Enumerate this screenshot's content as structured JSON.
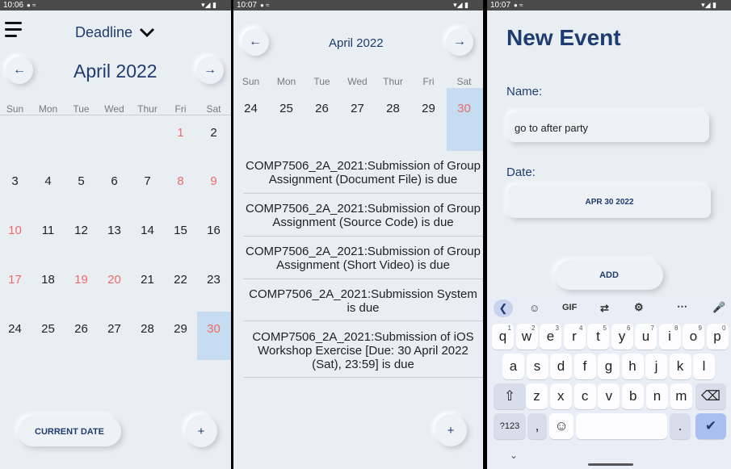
{
  "screen1": {
    "status_time": "10:06",
    "title": "Deadline",
    "month_label": "April 2022",
    "weekdays": [
      "Sun",
      "Mon",
      "Tue",
      "Wed",
      "Thur",
      "Fri",
      "Sat"
    ],
    "days": [
      [
        "",
        "",
        "",
        "",
        "",
        "1",
        "2"
      ],
      [
        "3",
        "4",
        "5",
        "6",
        "7",
        "8",
        "9"
      ],
      [
        "10",
        "11",
        "12",
        "13",
        "14",
        "15",
        "16"
      ],
      [
        "17",
        "18",
        "19",
        "20",
        "21",
        "22",
        "23"
      ],
      [
        "24",
        "25",
        "26",
        "27",
        "28",
        "29",
        "30"
      ]
    ],
    "red_days": [
      "1",
      "8",
      "9",
      "10",
      "17",
      "19",
      "20",
      "30"
    ],
    "selected_day": "30",
    "current_date_button": "CURRENT DATE",
    "add_button": "+",
    "prev_icon": "arrow-left-icon",
    "next_icon": "arrow-right-icon"
  },
  "screen2": {
    "status_time": "10:07",
    "month_label": "April 2022",
    "weekdays": [
      "Sun",
      "Mon",
      "Tue",
      "Wed",
      "Thur",
      "Fri",
      "Sat"
    ],
    "week_days": [
      "24",
      "25",
      "26",
      "27",
      "28",
      "29",
      "30"
    ],
    "selected_day": "30",
    "events": [
      "COMP7506_2A_2021:Submission of Group Assignment (Document File) is due",
      "COMP7506_2A_2021:Submission of Group Assignment (Source Code) is due",
      "COMP7506_2A_2021:Submission of Group Assignment (Short Video) is due",
      "COMP7506_2A_2021:Submission System is due",
      "COMP7506_2A_2021:Submission of iOS Workshop Exercise [Due: 30 April 2022 (Sat), 23:59] is due"
    ],
    "add_button": "+"
  },
  "screen3": {
    "status_time": "10:07",
    "title": "New Event",
    "name_label": "Name:",
    "name_value": "go to after party",
    "date_label": "Date:",
    "date_value": "APR 30 2022",
    "add_button": "ADD",
    "keyboard": {
      "toolbar": [
        "GIF"
      ],
      "row1": [
        [
          "q",
          "1"
        ],
        [
          "w",
          "2"
        ],
        [
          "e",
          "3"
        ],
        [
          "r",
          "4"
        ],
        [
          "t",
          "5"
        ],
        [
          "y",
          "6"
        ],
        [
          "u",
          "7"
        ],
        [
          "i",
          "8"
        ],
        [
          "o",
          "9"
        ],
        [
          "p",
          "0"
        ]
      ],
      "row2": [
        "a",
        "s",
        "d",
        "f",
        "g",
        "h",
        "j",
        "k",
        "l"
      ],
      "row3": [
        "z",
        "x",
        "c",
        "v",
        "b",
        "n",
        "m"
      ],
      "symbols_key": "?123",
      "comma_key": ",",
      "period_key": "."
    }
  },
  "colors": {
    "accent": "#1f3c70",
    "weekend_red": "#ee6a6a",
    "selected_bg": "#c6dcf0",
    "background": "#e9eef3"
  }
}
